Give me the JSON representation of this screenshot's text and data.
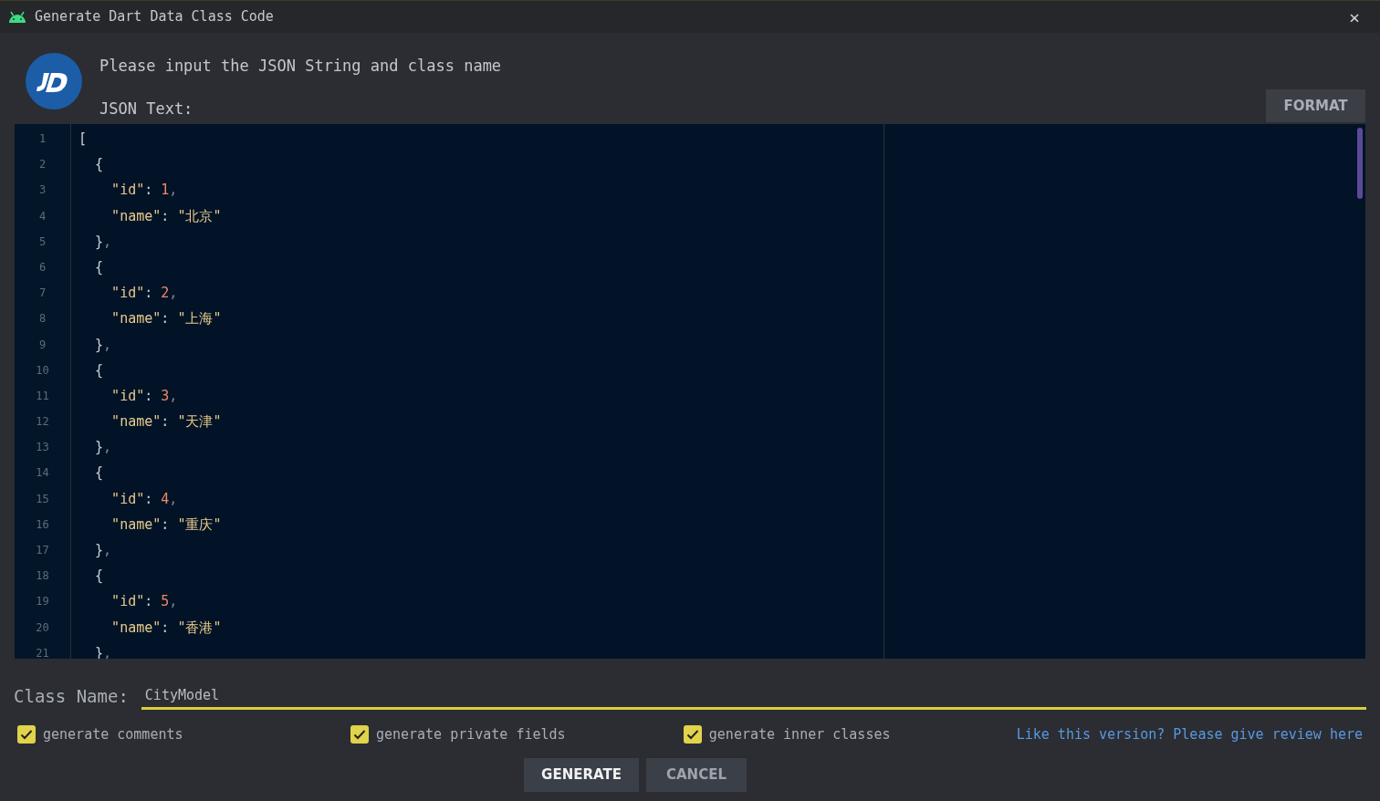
{
  "window": {
    "title": "Generate Dart Data Class Code",
    "close": "×"
  },
  "header": {
    "prompt": "Please input the JSON String and class name",
    "json_label": "JSON Text:",
    "format_button": "FORMAT"
  },
  "editor": {
    "lines": [
      {
        "number": "1",
        "tokens": [
          {
            "kind": "punct",
            "text": "["
          }
        ]
      },
      {
        "number": "2",
        "tokens": [
          {
            "kind": "punct",
            "text": "  {"
          }
        ]
      },
      {
        "number": "3",
        "tokens": [
          {
            "kind": "key",
            "text": "    \"id\""
          },
          {
            "kind": "colon",
            "text": ": "
          },
          {
            "kind": "number",
            "text": "1"
          },
          {
            "kind": "comma",
            "text": ","
          }
        ]
      },
      {
        "number": "4",
        "tokens": [
          {
            "kind": "key",
            "text": "    \"name\""
          },
          {
            "kind": "colon",
            "text": ": "
          },
          {
            "kind": "string",
            "text": "\"北京\""
          }
        ]
      },
      {
        "number": "5",
        "tokens": [
          {
            "kind": "punct",
            "text": "  }"
          },
          {
            "kind": "comma",
            "text": ","
          }
        ]
      },
      {
        "number": "6",
        "tokens": [
          {
            "kind": "punct",
            "text": "  {"
          }
        ]
      },
      {
        "number": "7",
        "tokens": [
          {
            "kind": "key",
            "text": "    \"id\""
          },
          {
            "kind": "colon",
            "text": ": "
          },
          {
            "kind": "number",
            "text": "2"
          },
          {
            "kind": "comma",
            "text": ","
          }
        ]
      },
      {
        "number": "8",
        "tokens": [
          {
            "kind": "key",
            "text": "    \"name\""
          },
          {
            "kind": "colon",
            "text": ": "
          },
          {
            "kind": "string",
            "text": "\"上海\""
          }
        ]
      },
      {
        "number": "9",
        "tokens": [
          {
            "kind": "punct",
            "text": "  }"
          },
          {
            "kind": "comma",
            "text": ","
          }
        ]
      },
      {
        "number": "10",
        "tokens": [
          {
            "kind": "punct",
            "text": "  {"
          }
        ]
      },
      {
        "number": "11",
        "tokens": [
          {
            "kind": "key",
            "text": "    \"id\""
          },
          {
            "kind": "colon",
            "text": ": "
          },
          {
            "kind": "number",
            "text": "3"
          },
          {
            "kind": "comma",
            "text": ","
          }
        ]
      },
      {
        "number": "12",
        "tokens": [
          {
            "kind": "key",
            "text": "    \"name\""
          },
          {
            "kind": "colon",
            "text": ": "
          },
          {
            "kind": "string",
            "text": "\"天津\""
          }
        ]
      },
      {
        "number": "13",
        "tokens": [
          {
            "kind": "punct",
            "text": "  }"
          },
          {
            "kind": "comma",
            "text": ","
          }
        ]
      },
      {
        "number": "14",
        "tokens": [
          {
            "kind": "punct",
            "text": "  {"
          }
        ]
      },
      {
        "number": "15",
        "tokens": [
          {
            "kind": "key",
            "text": "    \"id\""
          },
          {
            "kind": "colon",
            "text": ": "
          },
          {
            "kind": "number",
            "text": "4"
          },
          {
            "kind": "comma",
            "text": ","
          }
        ]
      },
      {
        "number": "16",
        "tokens": [
          {
            "kind": "key",
            "text": "    \"name\""
          },
          {
            "kind": "colon",
            "text": ": "
          },
          {
            "kind": "string",
            "text": "\"重庆\""
          }
        ]
      },
      {
        "number": "17",
        "tokens": [
          {
            "kind": "punct",
            "text": "  }"
          },
          {
            "kind": "comma",
            "text": ","
          }
        ]
      },
      {
        "number": "18",
        "tokens": [
          {
            "kind": "punct",
            "text": "  {"
          }
        ]
      },
      {
        "number": "19",
        "tokens": [
          {
            "kind": "key",
            "text": "    \"id\""
          },
          {
            "kind": "colon",
            "text": ": "
          },
          {
            "kind": "number",
            "text": "5"
          },
          {
            "kind": "comma",
            "text": ","
          }
        ]
      },
      {
        "number": "20",
        "tokens": [
          {
            "kind": "key",
            "text": "    \"name\""
          },
          {
            "kind": "colon",
            "text": ": "
          },
          {
            "kind": "string",
            "text": "\"香港\""
          }
        ]
      },
      {
        "number": "21",
        "tokens": [
          {
            "kind": "punct",
            "text": "  }"
          },
          {
            "kind": "comma",
            "text": ","
          }
        ]
      }
    ]
  },
  "class_name": {
    "label": "Class Name:",
    "value": "CityModel"
  },
  "options": [
    {
      "label": "generate comments",
      "checked": true
    },
    {
      "label": "generate private fields",
      "checked": true
    },
    {
      "label": "generate inner classes",
      "checked": true
    }
  ],
  "review_link": "Like this version? Please give review here",
  "buttons": [
    {
      "label": "GENERATE",
      "kind": "primary"
    },
    {
      "label": "CANCEL",
      "kind": "secondary"
    }
  ]
}
